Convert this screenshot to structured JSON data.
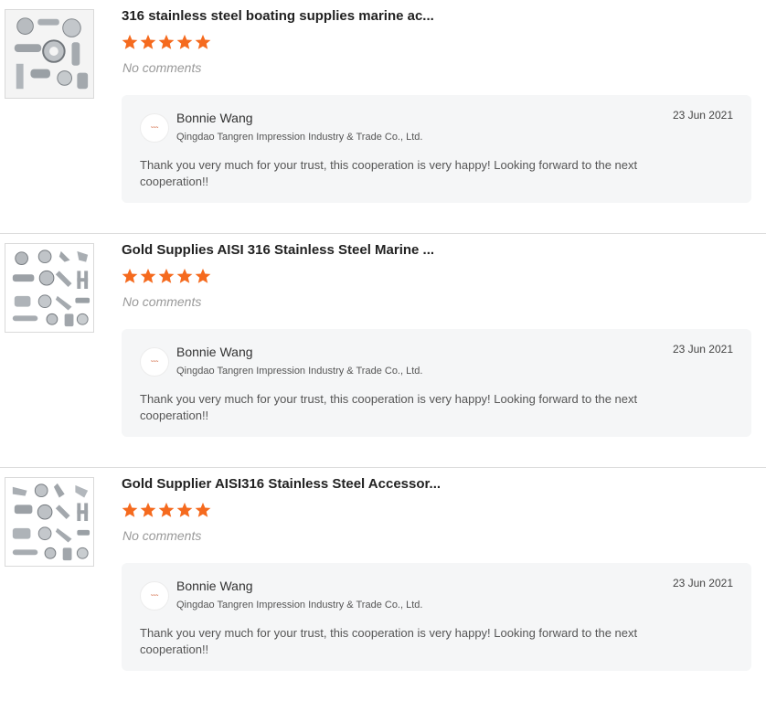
{
  "accent_color": "#f56a1e",
  "reviews": [
    {
      "thumbnail_icon": "stainless-marine-hardware-photo",
      "product_title": "316 stainless steel boating supplies marine ac...",
      "rating": 5,
      "comment_state": "No comments",
      "reply": {
        "seller_name": "Bonnie Wang",
        "company": "Qingdao Tangren Impression Industry & Trade Co., Ltd.",
        "date": "23 Jun 2021",
        "text": "Thank you very much for your trust, this cooperation is very happy! Looking forward to the next cooperation!!"
      }
    },
    {
      "thumbnail_icon": "stainless-marine-hardware-photo",
      "product_title": "Gold Supplies AISI 316 Stainless Steel Marine ...",
      "rating": 5,
      "comment_state": "No comments",
      "reply": {
        "seller_name": "Bonnie Wang",
        "company": "Qingdao Tangren Impression Industry & Trade Co., Ltd.",
        "date": "23 Jun 2021",
        "text": "Thank you very much for your trust, this cooperation is very happy! Looking forward to the next cooperation!!"
      }
    },
    {
      "thumbnail_icon": "stainless-marine-hardware-photo",
      "product_title": "Gold Supplier AISI316 Stainless Steel Accessor...",
      "rating": 5,
      "comment_state": "No comments",
      "reply": {
        "seller_name": "Bonnie Wang",
        "company": "Qingdao Tangren Impression Industry & Trade Co., Ltd.",
        "date": "23 Jun 2021",
        "text": "Thank you very much for your trust, this cooperation is very happy! Looking forward to the next cooperation!!"
      }
    }
  ]
}
